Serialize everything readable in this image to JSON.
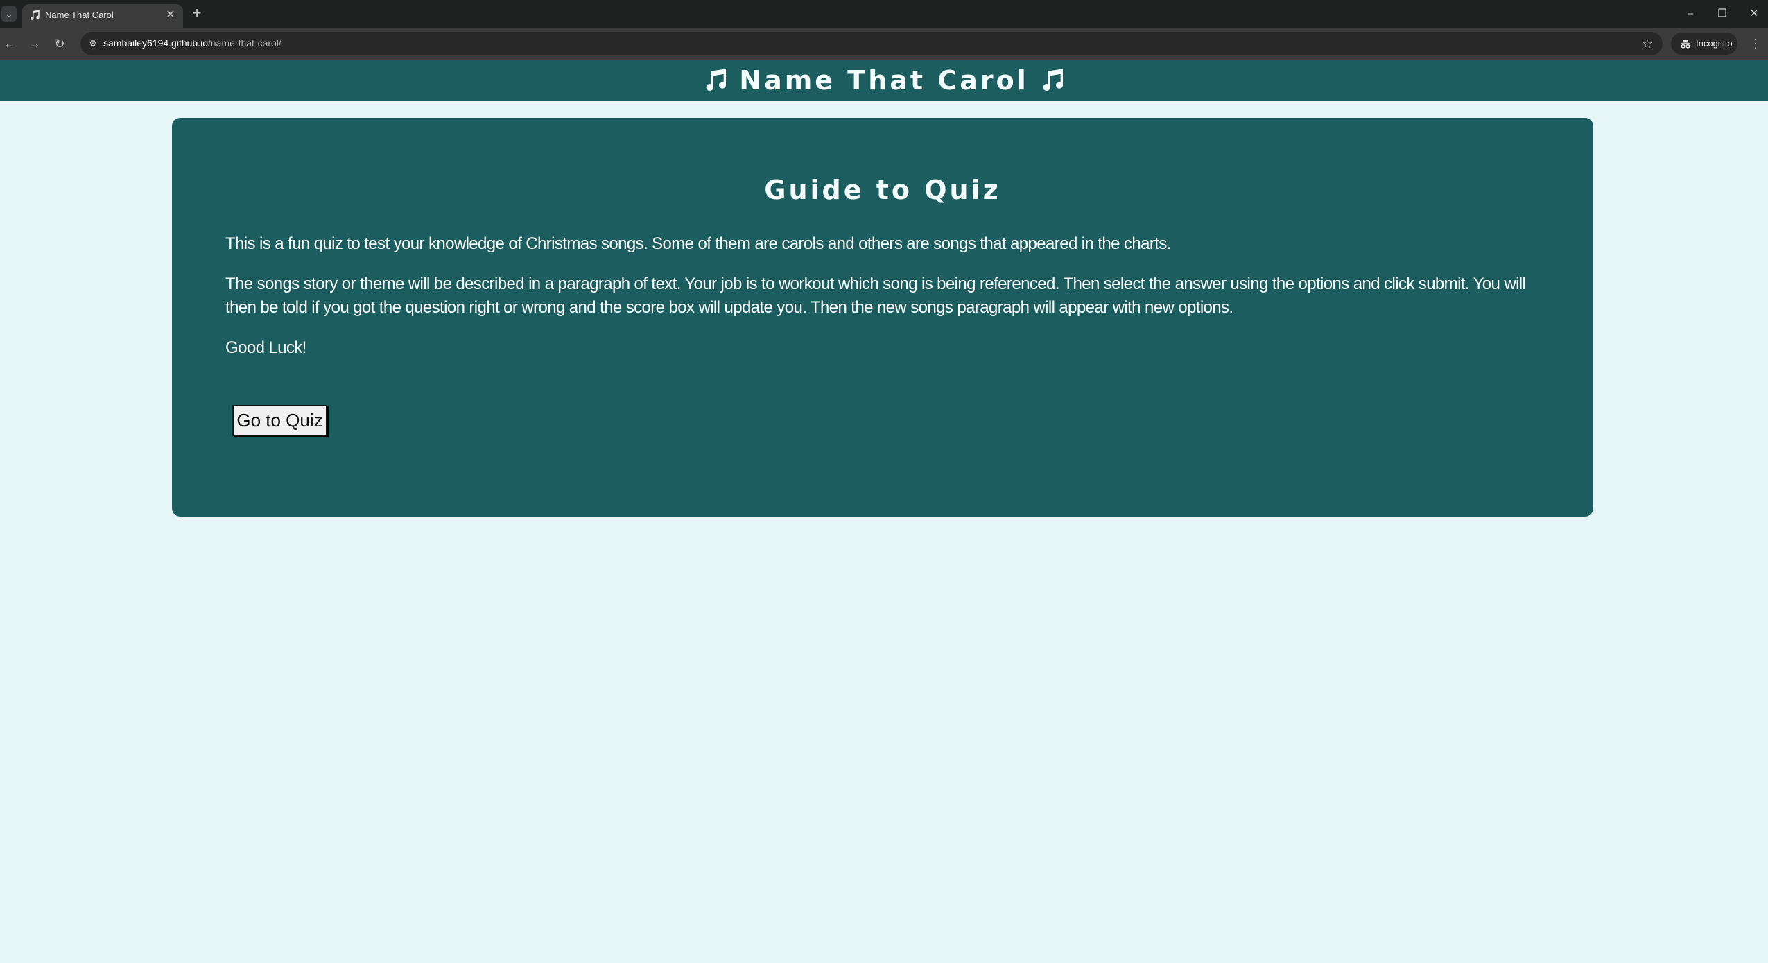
{
  "browser": {
    "tab_title": "Name That Carol",
    "url_host": "sambailey6194.github.io",
    "url_path": "/name-that-carol/",
    "incognito_label": "Incognito"
  },
  "header": {
    "title": "Name That Carol"
  },
  "guide": {
    "heading": "Guide to Quiz",
    "paragraph_1": "This is a fun quiz to test your knowledge of Christmas songs. Some of them are carols and others are songs that appeared in the charts.",
    "paragraph_2": "The songs story or theme will be described in a paragraph of text. Your job is to workout which song is being referenced. Then select the answer using the options and click submit. You will then be told if you got the question right or wrong and the score box will update you. Then the new songs paragraph will appear with new options.",
    "paragraph_3": "Good Luck!",
    "button_label": "Go to Quiz"
  },
  "colors": {
    "page_background": "#e6f5f5",
    "brand_teal": "#1c5e60",
    "text_light": "#ffffff"
  },
  "icons": {
    "title_icon": "music-note-icon"
  }
}
